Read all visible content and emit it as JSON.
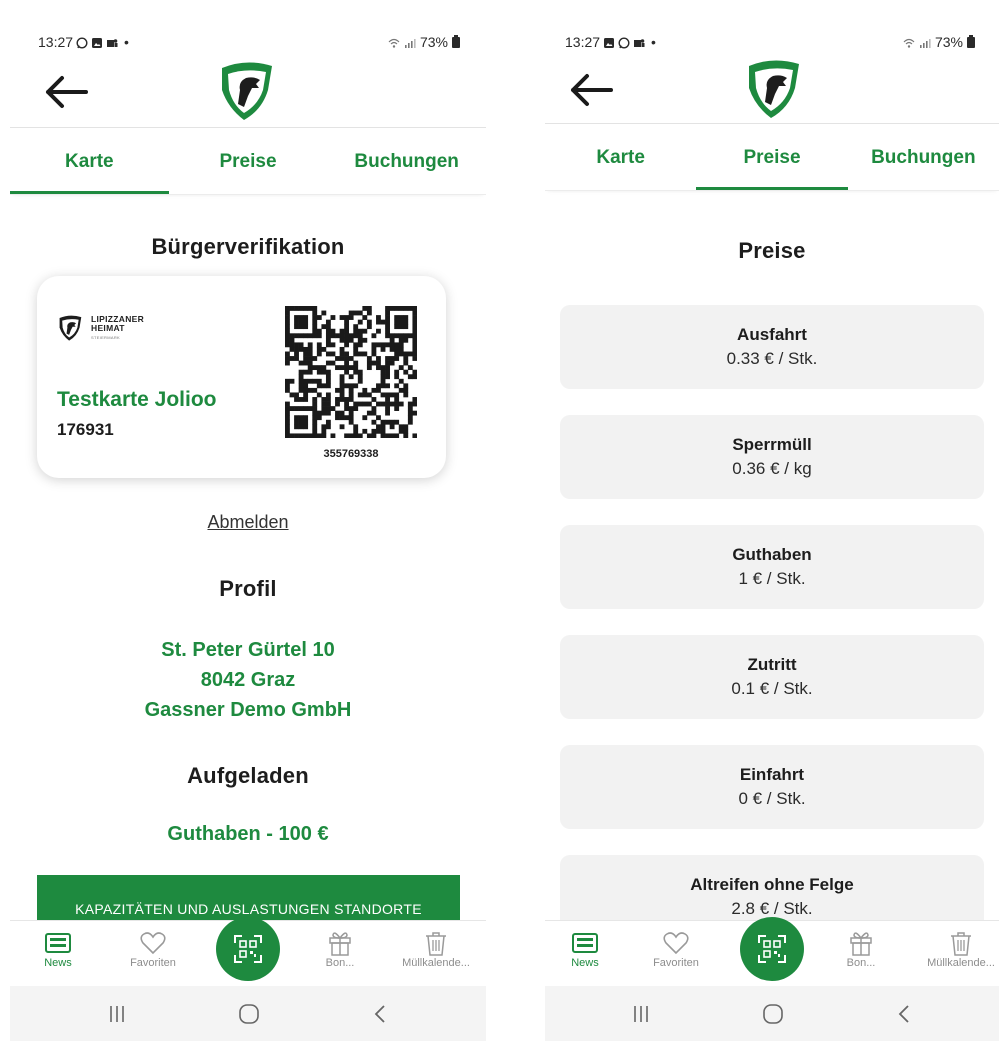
{
  "status_bar": {
    "left": {
      "time": "13:27"
    },
    "right": {
      "time": "13:27"
    },
    "battery": "73%"
  },
  "tabs": [
    {
      "label": "Karte"
    },
    {
      "label": "Preise"
    },
    {
      "label": "Buchungen"
    }
  ],
  "card_screen": {
    "active_tab": "Karte",
    "title": "Bürgerverifikation",
    "card": {
      "brand_line1": "LIPIZZANER",
      "brand_line2": "HEIMAT",
      "brand_line3": "STEIERMARK",
      "name": "Testkarte Jolioo",
      "number": "176931",
      "qr_number": "355769338"
    },
    "logout_label": "Abmelden",
    "profile_title": "Profil",
    "address_street": "St. Peter Gürtel 10",
    "address_city": "8042 Graz",
    "address_company": "Gassner Demo GmbH",
    "charged_title": "Aufgeladen",
    "charged_value": "Guthaben - 100 €",
    "cta_label": "KAPAZITÄTEN UND AUSLASTUNGEN STANDORTE"
  },
  "prices_screen": {
    "active_tab": "Preise",
    "title": "Preise",
    "items": [
      {
        "name": "Ausfahrt",
        "price": "0.33 € / Stk."
      },
      {
        "name": "Sperrmüll",
        "price": "0.36 € / kg"
      },
      {
        "name": "Guthaben",
        "price": "1 € / Stk."
      },
      {
        "name": "Zutritt",
        "price": "0.1 € / Stk."
      },
      {
        "name": "Einfahrt",
        "price": "0 € / Stk."
      },
      {
        "name": "Altreifen ohne Felge",
        "price": "2.8 € / Stk."
      }
    ]
  },
  "bottom_nav": [
    {
      "label": "News",
      "icon": "news-icon",
      "active": true
    },
    {
      "label": "Favoriten",
      "icon": "heart-icon",
      "active": false
    },
    {
      "label": "",
      "icon": "qr-scan-icon",
      "active": false
    },
    {
      "label": "Bon...",
      "icon": "gift-icon",
      "active": false
    },
    {
      "label": "Müllkalende...",
      "icon": "trash-icon",
      "active": false
    }
  ],
  "colors": {
    "brand_green": "#1e8a3f",
    "price_card_bg": "#f2f2f2",
    "inactive_nav": "#8d8d8d"
  }
}
